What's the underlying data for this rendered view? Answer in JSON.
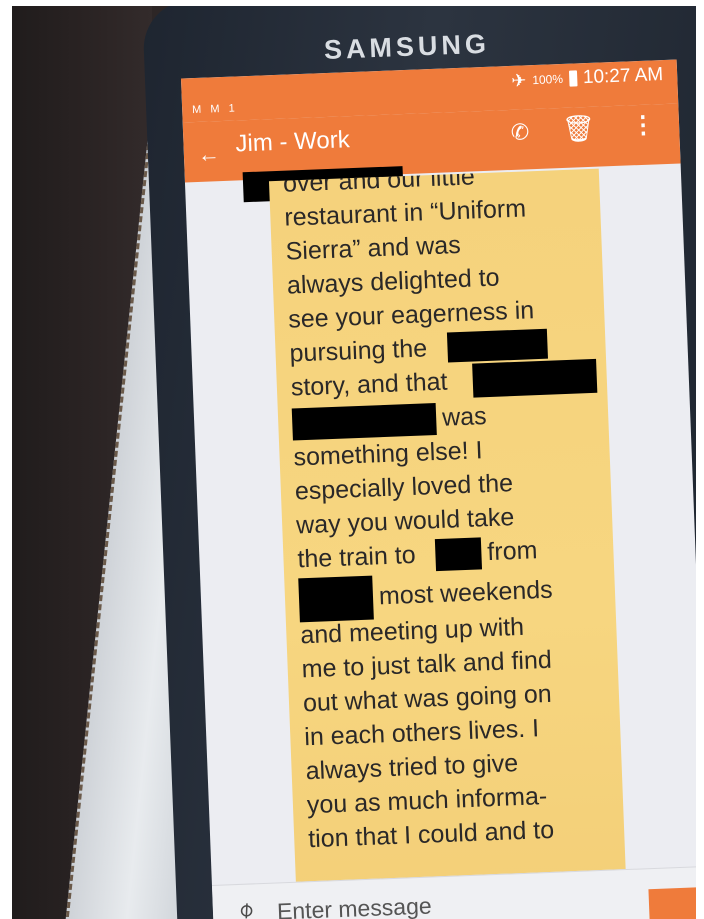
{
  "phone": {
    "brand": "SAMSUNG"
  },
  "status_bar": {
    "notification_icons": "M M 1",
    "battery_percent": "100%",
    "time": "10:27 AM"
  },
  "app_bar": {
    "contact_name": "Jim - Work",
    "back_icon": "back-arrow-icon",
    "call_icon": "phone-icon",
    "delete_icon": "trash-icon",
    "more_icon": "more-vertical-icon"
  },
  "message": {
    "lines": [
      "over and our little",
      "restaurant in “Uniform",
      "Sierra” and was",
      "always delighted to",
      "see your eagerness in",
      "pursuing the",
      "story, and that",
      "was",
      "something else!  I",
      "especially loved the",
      "way you would take",
      "the train to",
      "from",
      "most weekends",
      "and meeting up with",
      "me to just talk and find",
      "out what was going on",
      "in each others lives.  I",
      "always tried to give",
      "you as much informa-",
      "tion that I could and to"
    ]
  },
  "compose": {
    "placeholder": "Enter message"
  },
  "colors": {
    "accent": "#ef7b3b",
    "bubble": "#f6d47e",
    "redaction": "#000000"
  }
}
